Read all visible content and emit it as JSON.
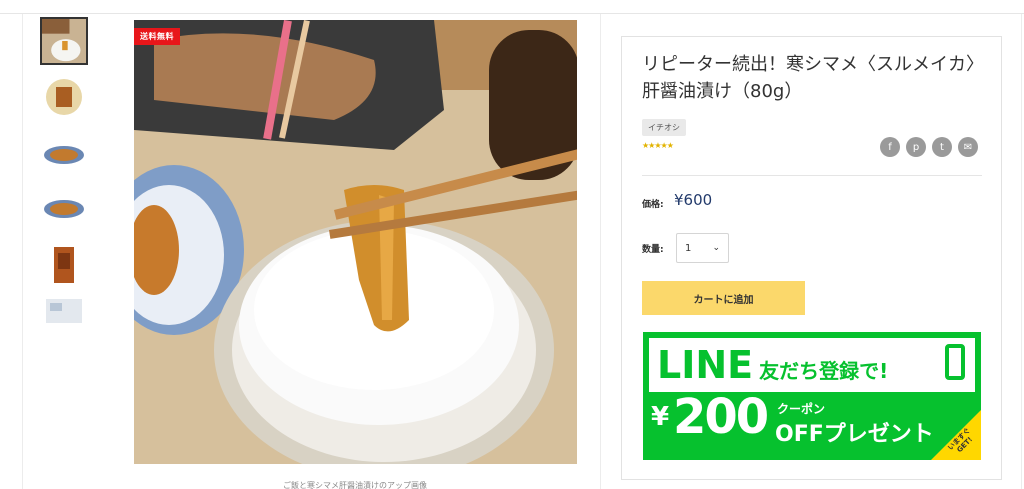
{
  "product": {
    "title": "リピーター続出！寒シマメ〈スルメイカ〉肝醤油漬け（80g）",
    "tag": "イチオシ",
    "stars": "★★★★★",
    "price_label": "価格:",
    "price": "¥600",
    "quantity_label": "数量:",
    "quantity_value": "1",
    "add_to_cart": "カートに追加"
  },
  "gallery": {
    "badge": "送料無料",
    "caption": "ご飯と寒シマメ肝醤油漬けのアップ画像"
  },
  "share": {
    "icons": [
      "facebook-icon",
      "pinterest-icon",
      "twitter-icon",
      "mail-icon"
    ],
    "glyphs": [
      "f",
      "p",
      "t",
      "✉"
    ]
  },
  "line_banner": {
    "line_text": "LINE",
    "friend_text": "友だち登録で!",
    "yen": "¥",
    "amount": "200",
    "coupon_text": "クーポン",
    "off_text": "OFFプレゼント",
    "corner_text": "いますぐ GET!",
    "colors": {
      "green": "#06c12e",
      "corner": "#ffd700"
    }
  },
  "colors": {
    "cart_button": "#fbd86b",
    "price": "#223a6b",
    "badge": "#e8161a"
  }
}
